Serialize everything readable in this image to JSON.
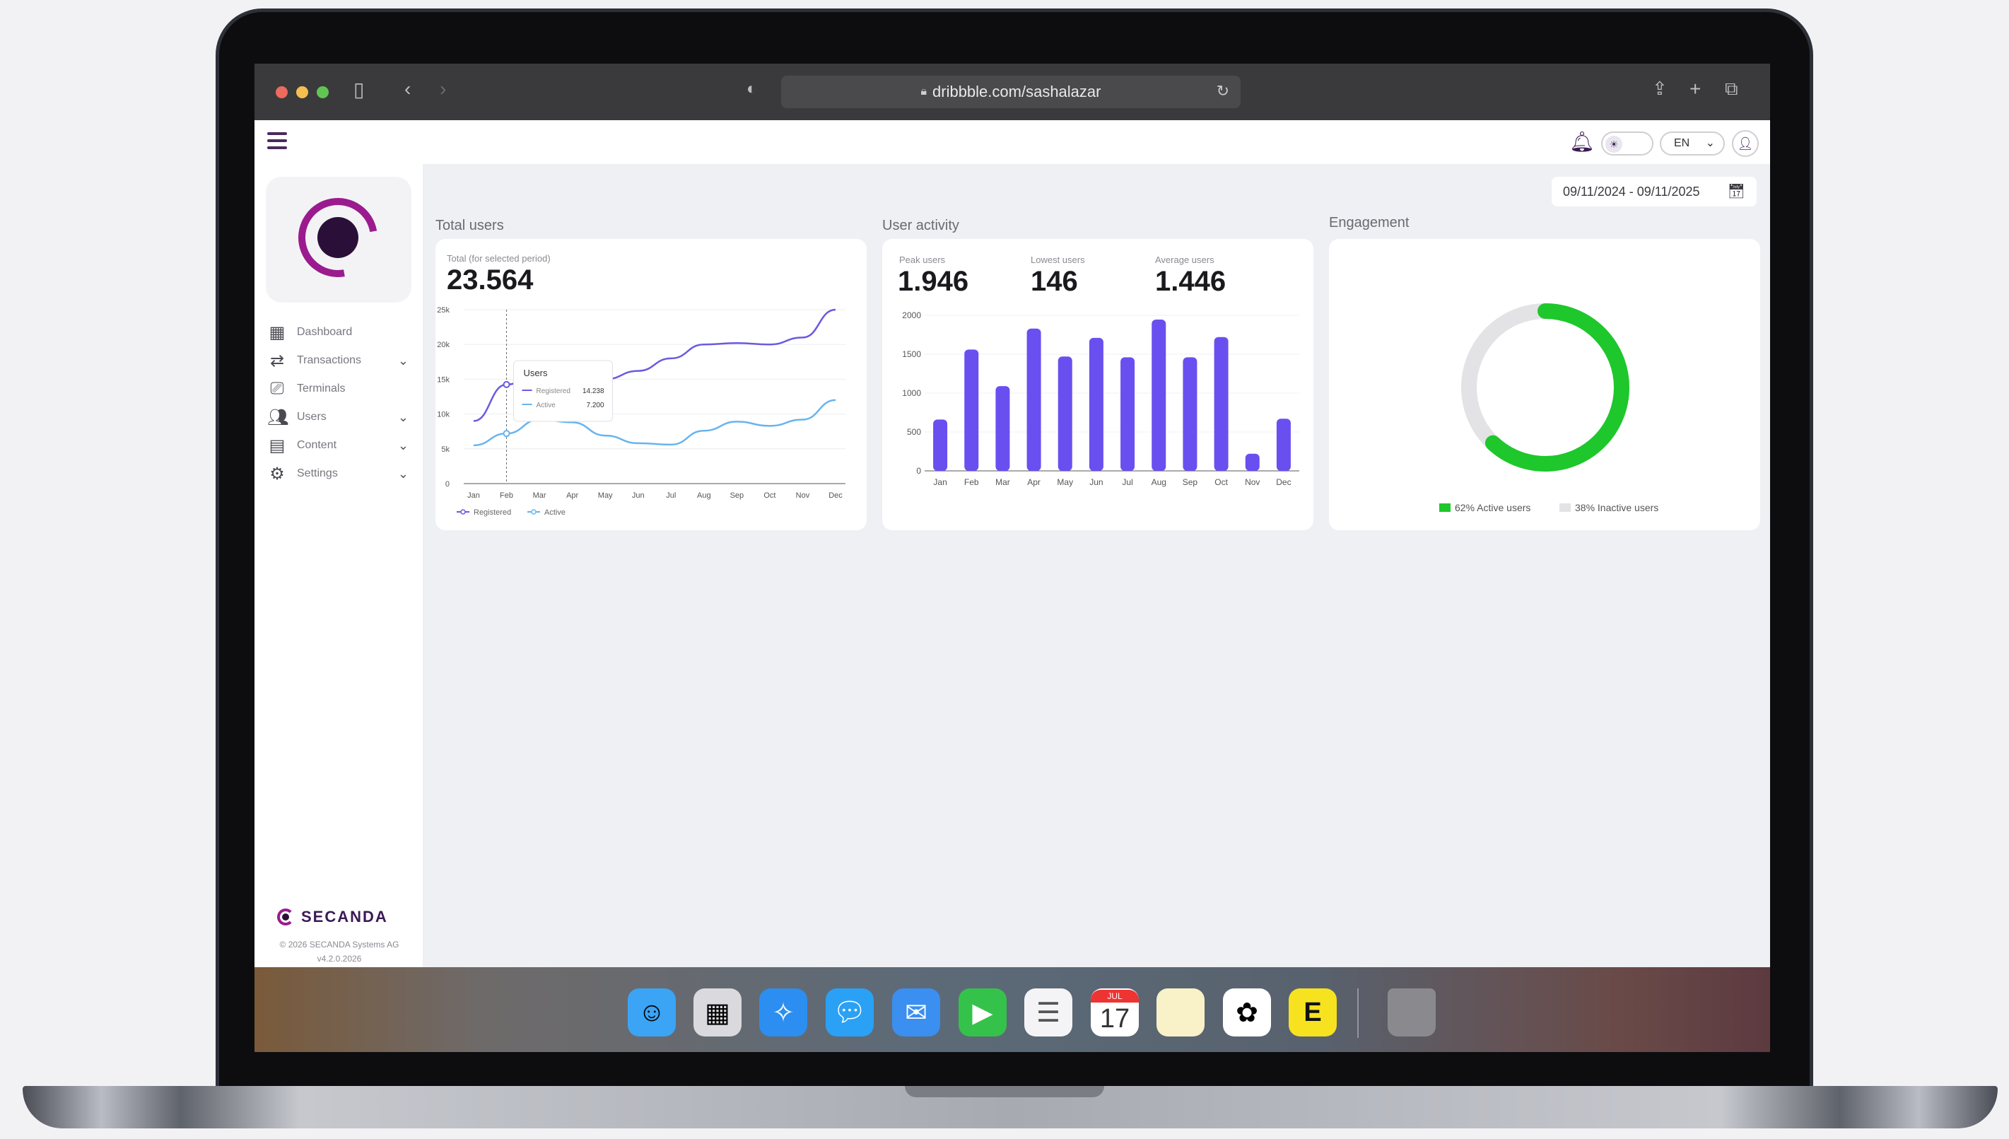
{
  "browser": {
    "url": "dribbble.com/sashalazar"
  },
  "header": {
    "language": "EN"
  },
  "sidebar": {
    "items": [
      {
        "label": "Dashboard",
        "icon": "grid-icon",
        "has_chevron": false
      },
      {
        "label": "Transactions",
        "icon": "transactions-icon",
        "has_chevron": true
      },
      {
        "label": "Terminals",
        "icon": "terminal-icon",
        "has_chevron": false
      },
      {
        "label": "Users",
        "icon": "users-icon",
        "has_chevron": true
      },
      {
        "label": "Content",
        "icon": "content-icon",
        "has_chevron": true
      },
      {
        "label": "Settings",
        "icon": "gear-icon",
        "has_chevron": true
      }
    ],
    "brand": "SECANDA",
    "copyright": "© 2026 SECANDA Systems AG",
    "version": "v4.2.0.2026"
  },
  "main": {
    "date_range": "09/11/2024 - 09/11/2025",
    "total_users": {
      "title": "Total users",
      "kpi_label": "Total (for selected period)",
      "kpi_value": "23.564",
      "tooltip": {
        "title": "Users",
        "rows": [
          {
            "label": "Registered",
            "value": "14.238"
          },
          {
            "label": "Active",
            "value": "7.200"
          }
        ]
      }
    },
    "user_activity": {
      "title": "User activity",
      "kpis": [
        {
          "label": "Peak users",
          "value": "1.946"
        },
        {
          "label": "Lowest users",
          "value": "146"
        },
        {
          "label": "Average users",
          "value": "1.446"
        }
      ]
    },
    "engagement": {
      "title": "Engagement",
      "legend": [
        {
          "label": "62% Active users",
          "color": "#1ec72b"
        },
        {
          "label": "38% Inactive users",
          "color": "#e3e3e6"
        }
      ]
    }
  },
  "chart_data": [
    {
      "type": "line",
      "x": [
        "Jan",
        "Feb",
        "Mar",
        "Apr",
        "May",
        "Jun",
        "Jul",
        "Aug",
        "Sep",
        "Oct",
        "Nov",
        "Dec"
      ],
      "yticks": [
        "0",
        "5k",
        "10k",
        "15k",
        "20k",
        "25k"
      ],
      "ylim": [
        0,
        25000
      ],
      "series": [
        {
          "name": "Registered",
          "color": "#6a5ae0",
          "values": [
            9000,
            14238,
            16000,
            15200,
            15000,
            16200,
            18000,
            20000,
            20200,
            20000,
            21000,
            25000
          ]
        },
        {
          "name": "Active",
          "color": "#68b4ee",
          "values": [
            5500,
            7200,
            9200,
            8800,
            6900,
            5800,
            5600,
            7600,
            8900,
            8300,
            9200,
            12000
          ]
        }
      ],
      "grid": true,
      "legend": "bottom-left"
    },
    {
      "type": "bar",
      "categories": [
        "Jan",
        "Feb",
        "Mar",
        "Apr",
        "May",
        "Jun",
        "Jul",
        "Aug",
        "Sep",
        "Oct",
        "Nov",
        "Dec"
      ],
      "values": [
        660,
        1560,
        1090,
        1830,
        1470,
        1710,
        1460,
        1946,
        1460,
        1720,
        220,
        670
      ],
      "yticks": [
        "0",
        "500",
        "1000",
        "1500",
        "2000"
      ],
      "ylim": [
        0,
        2000
      ],
      "color": "#6a4ff0",
      "grid": true
    },
    {
      "type": "pie",
      "donut": true,
      "labels": [
        "62% Active users",
        "38% Inactive users"
      ],
      "values": [
        62,
        38
      ],
      "colors": [
        "#1ec72b",
        "#e3e3e6"
      ],
      "legend": "bottom"
    }
  ]
}
